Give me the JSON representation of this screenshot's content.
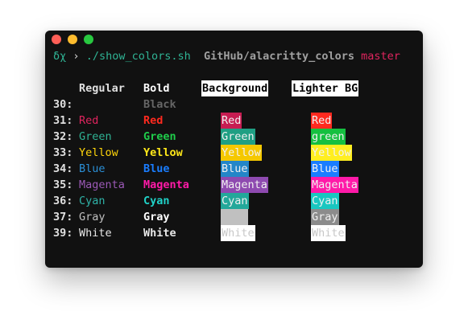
{
  "prompt": {
    "symbol": "δχ",
    "arrow": "›",
    "command": "./show_colors.sh",
    "dir_prefix": "GitHub",
    "dir_sep": "/",
    "dir_name": "alacritty_colors",
    "branch": "master"
  },
  "headers": {
    "regular": "Regular",
    "bold": "Bold",
    "background": "Background",
    "lighter_bg": "Lighter BG"
  },
  "rows": [
    {
      "num": "30:",
      "regular": "",
      "bold": "Black",
      "background": "",
      "lighter": "",
      "fg": "#000000",
      "bold_fg": "#666666",
      "bg_color": "transparent",
      "lbg_color": "transparent"
    },
    {
      "num": "31:",
      "regular": "Red",
      "bold": "Red",
      "background": "Red",
      "lighter": "Red",
      "fg": "#e0245e",
      "bold_fg": "#ff2a1f",
      "bg_color": "#c71d52",
      "lbg_color": "#ff2a1f"
    },
    {
      "num": "32:",
      "regular": "Green",
      "bold": "Green",
      "background": "Green",
      "lighter": "green",
      "fg": "#2fb394",
      "bold_fg": "#1fcc4a",
      "bg_color": "#1f9f83",
      "lbg_color": "#15c040"
    },
    {
      "num": "33:",
      "regular": "Yellow",
      "bold": "Yellow",
      "background": "Yellow",
      "lighter": "Yellow",
      "fg": "#ffd50a",
      "bold_fg": "#ffe81a",
      "bg_color": "#f5c800",
      "lbg_color": "#ffee20"
    },
    {
      "num": "34:",
      "regular": "Blue",
      "bold": "Blue",
      "background": "Blue",
      "lighter": "Blue",
      "fg": "#2b8fd6",
      "bold_fg": "#1a7dff",
      "bg_color": "#2386c8",
      "lbg_color": "#1a7dff"
    },
    {
      "num": "35:",
      "regular": "Magenta",
      "bold": "Magenta",
      "background": "Magenta",
      "lighter": "Magenta",
      "fg": "#9b59b6",
      "bold_fg": "#ff1aa8",
      "bg_color": "#8e4ab0",
      "lbg_color": "#ff1aa8"
    },
    {
      "num": "36:",
      "regular": "Cyan",
      "bold": "Cyan",
      "background": "Cyan",
      "lighter": "Cyan",
      "fg": "#2fb3a8",
      "bold_fg": "#20d2c8",
      "bg_color": "#23a89a",
      "lbg_color": "#19c7c0"
    },
    {
      "num": "37:",
      "regular": "Gray",
      "bold": "Gray",
      "background": "",
      "lighter": "Gray",
      "fg": "#c0c0c0",
      "bold_fg": "#ffffff",
      "bg_color": "#c0c0c0",
      "lbg_color": "#8c8c8c"
    },
    {
      "num": "39:",
      "regular": "White",
      "bold": "White",
      "background": "White",
      "lighter": "White",
      "fg": "#e8e8e8",
      "bold_fg": "#e8e8e8",
      "bg_color": "#ffffff",
      "lbg_color": "#ffffff"
    }
  ],
  "colors": {
    "window_bg": "#111111",
    "prompt_accent": "#2fb394",
    "branch": "#e0245e",
    "bg_text_on_light": "#c8c8c8"
  }
}
